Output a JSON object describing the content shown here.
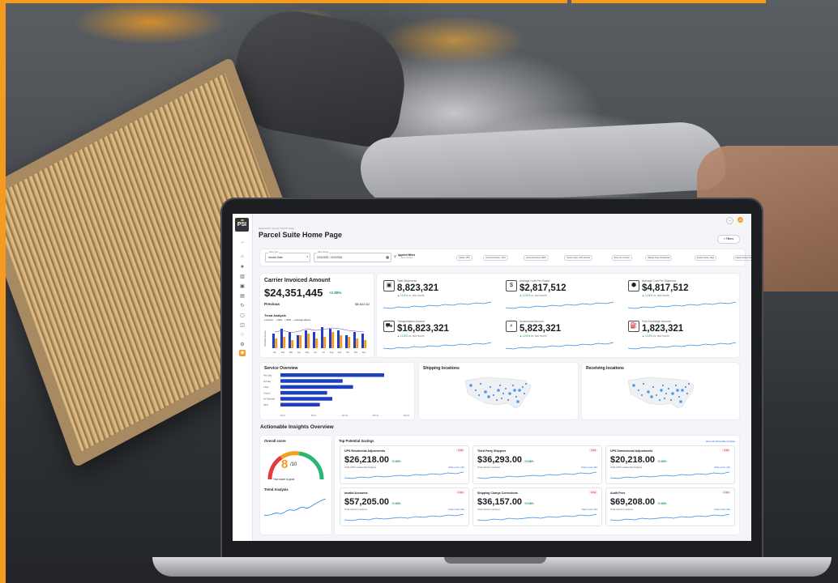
{
  "app": {
    "logo": "PSI",
    "breadcrumb": "Dashboard / Home / Parcel Suite",
    "page_title": "Parcel Suite Home Page",
    "filters_label": "Filters",
    "avatar_initials": "JS"
  },
  "filterbar": {
    "date_type_label": "Date Type",
    "date_type_value": "Invoice Date",
    "date_range_label": "Date Range",
    "date_range_value": "1/01/2023 - 1/01/2024",
    "applied_filters": "Applied filters",
    "applied_sub": "Clear all filters",
    "chips": [
      "Carrier: UPS",
      "Account Number: 1234",
      "Account Number: 5678",
      "Service Type: UPS Ground",
      "Zone: 02 +3 more",
      "Shipper Type: Residential",
      "Invoice Group: Tag1",
      "Carrier Group: Invoice",
      "Clear all"
    ]
  },
  "carrier_card": {
    "title": "Carrier Invoiced Amount",
    "value": "$24,351,445",
    "change": "+2.88%",
    "previous_label": "Previous",
    "previous_value": "$8,522.62",
    "trend_title": "Trend Analysis",
    "legend": [
      "Current",
      "2022",
      "2023",
      "Average Volume"
    ],
    "months": [
      "Jan",
      "Feb",
      "Mar",
      "Apr",
      "May",
      "Jun",
      "Jul",
      "Aug",
      "Sep",
      "Oct",
      "Nov",
      "Dec"
    ],
    "y_label": "Actionable Invoices"
  },
  "metrics": [
    {
      "label": "Total Shipments",
      "value": "8,823,321",
      "change": "▲ 12.8%",
      "period": "vs. last month",
      "icon": "package-icon"
    },
    {
      "label": "Average Cost Per Pound",
      "value": "$2,817,512",
      "change": "▲ 12.8%",
      "period": "vs. last month",
      "icon": "dollar-icon"
    },
    {
      "label": "Average Cost Per Shipment",
      "value": "$4,817,512",
      "change": "▲ 12.8%",
      "period": "vs. last month",
      "icon": "boxes-icon"
    },
    {
      "label": "Transportation Amount",
      "value": "$16,823,321",
      "change": "▲ 12.8%",
      "period": "vs. last month",
      "icon": "truck-icon"
    },
    {
      "label": "Accessorial Amount",
      "value": "5,823,321",
      "change": "▲ 12.8%",
      "period": "vs. last month",
      "icon": "search-dollar-icon"
    },
    {
      "label": "Fuel Surcharge Amount",
      "value": "1,823,321",
      "change": "▲ 12.8%",
      "period": "vs. last month",
      "icon": "fuel-icon"
    }
  ],
  "service_overview": {
    "title": "Service Overview",
    "categories": [
      "Next Day",
      "2nd Day",
      "3 Day",
      "Ground",
      "Intl Standard",
      "Other"
    ],
    "values": [
      100,
      60,
      70,
      45,
      50,
      38
    ],
    "ticks": [
      "$0.00",
      "$5.00",
      "$10.00",
      "$15.00",
      "$20.00"
    ]
  },
  "shipping_title": "Shipping locations",
  "receiving_title": "Receiving locations",
  "insights": {
    "title": "Actionable Insights Overview",
    "overall_score_title": "Overall score",
    "score": "8",
    "score_of": "/10",
    "score_caption": "Your score is good",
    "trend_title": "Trend Analysis",
    "savings_title": "Top Potential Savings",
    "view_all": "View All Actionable Insights",
    "cards": [
      {
        "title": "UPS Residential Adjustments",
        "value": "$26,218.00",
        "pct": "+2.88%",
        "sub": "Total UPS residential charges",
        "more": "View more info",
        "badge": "1 hr"
      },
      {
        "title": "Third Party Shippers",
        "value": "$36,293.00",
        "pct": "+2.88%",
        "sub": "Total carrier invoiced",
        "more": "View more info",
        "badge": "1 hr"
      },
      {
        "title": "UPS Dimensional Adjustments",
        "value": "$20,218.00",
        "pct": "+2.88%",
        "sub": "Total UPS residential charges",
        "more": "View more info",
        "badge": "1 hr"
      },
      {
        "title": "Invalid Accounts",
        "value": "$57,205.00",
        "pct": "+2.88%",
        "sub": "Total carrier invoiced",
        "more": "View more info",
        "badge": "1 hr"
      },
      {
        "title": "Shipping Charge Corrections",
        "value": "$36,157.00",
        "pct": "+2.88%",
        "sub": "Total carrier invoiced",
        "more": "View more info",
        "badge": "1 hr"
      },
      {
        "title": "Audit Fees",
        "value": "$69,208.00",
        "pct": "+2.88%",
        "sub": "Total carrier invoiced",
        "more": "View more info",
        "badge": "1 hr"
      }
    ]
  },
  "colors": {
    "accent": "#f39a1f",
    "bar_blue": "#1f3fbf",
    "green": "#1f9d55",
    "dot_blue": "#2f8be6"
  }
}
